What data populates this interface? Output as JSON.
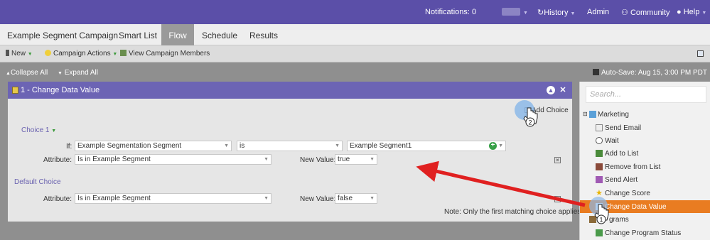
{
  "topbar": {
    "notifications": "Notifications: 0",
    "history": "History",
    "admin": "Admin",
    "community": "Community",
    "help": "Help"
  },
  "tabs": [
    "Example Segment Campaign",
    "Smart List",
    "Flow",
    "Schedule",
    "Results"
  ],
  "active_tab": "Flow",
  "toolbar": {
    "new": "New",
    "campaign_actions": "Campaign Actions",
    "view_members": "View Campaign Members"
  },
  "collapse": {
    "collapse_all": "Collapse All",
    "expand_all": "Expand All",
    "autosave": "Auto-Save: Aug 15, 3:00 PM PDT"
  },
  "step": {
    "title": "1 - Change Data Value",
    "add_choice": "Add Choice",
    "choice_label": "Choice 1",
    "if_label": "If:",
    "if_field": "Example Segmentation Segment",
    "operator": "is",
    "value": "Example Segment1",
    "attribute_label": "Attribute:",
    "attribute_value": "Is in Example Segment",
    "new_value_label": "New Value:",
    "new_value": "true",
    "default_label": "Default Choice",
    "default_attribute": "Is in Example Segment",
    "default_new_value": "false",
    "note": "Note: Only the first matching choice applies"
  },
  "sidebar": {
    "search_placeholder": "Search...",
    "group": "Marketing",
    "items": [
      "Send Email",
      "Wait",
      "Add to List",
      "Remove from List",
      "Send Alert",
      "Change Score",
      "Change Data Value"
    ],
    "programs_label": "grams",
    "program_items": [
      "Change Program Status"
    ]
  },
  "callouts": [
    "1",
    "2"
  ],
  "colors": {
    "topbar": "#5b4fa8",
    "panel_header": "#6c64b4",
    "selected": "#e97c21",
    "arrow": "#e02020"
  }
}
